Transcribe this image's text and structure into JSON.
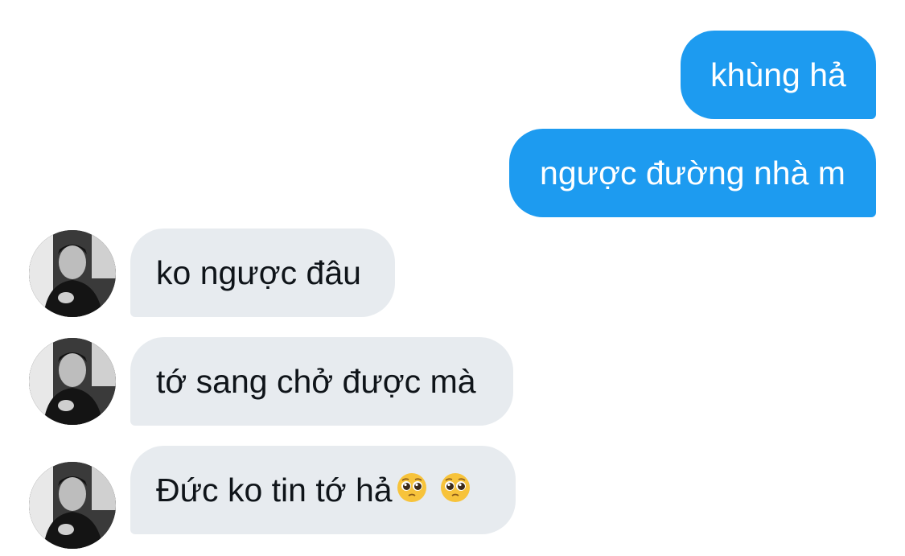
{
  "conversation": {
    "sent": [
      {
        "text": "khùng hả"
      },
      {
        "text": "ngược đường nhà m"
      }
    ],
    "received": [
      {
        "text": "ko ngược đâu",
        "emojis": []
      },
      {
        "text": "tớ sang chở được mà",
        "emojis": []
      },
      {
        "text": "Đức ko tin tớ hả",
        "emojis": [
          "pleading-face",
          "pleading-face"
        ]
      }
    ]
  },
  "colors": {
    "sent_bubble": "#1d9bf0",
    "received_bubble": "#e7ebef"
  }
}
